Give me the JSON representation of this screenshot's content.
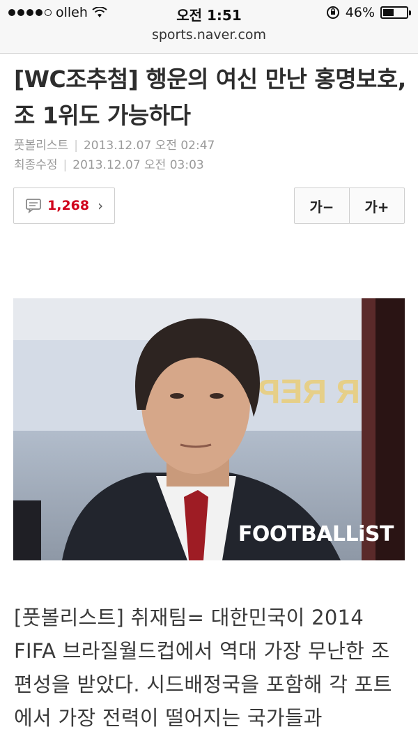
{
  "status_bar": {
    "carrier": "olleh",
    "time": "오전 1:51",
    "battery": "46%",
    "battery_level": 0.46
  },
  "url_bar": {
    "url": "sports.naver.com"
  },
  "article": {
    "headline": "[WC조추첨] 행운의 여신 만난 홍명보호, 조 1위도 가능하다",
    "source": "풋볼리스트",
    "published": "2013.12.07 오전 02:47",
    "modified_label": "최종수정",
    "modified": "2013.12.07 오전 03:03",
    "comment_count": "1,268",
    "font_decrease_label": "가−",
    "font_increase_label": "가+",
    "photo_watermark": "FOOTBALLiST",
    "body": "[풋볼리스트] 취재팀= 대한민국이 2014 FIFA 브라질월드컵에서 역대 가장 무난한 조편성을 받았다. 시드배정국을 포함해 각 포트에서 가장 전력이 떨어지는 국가들과"
  },
  "colors": {
    "accent_comment": "#d0021b",
    "headline": "#2d2d2d",
    "meta": "#9a9a9a"
  }
}
